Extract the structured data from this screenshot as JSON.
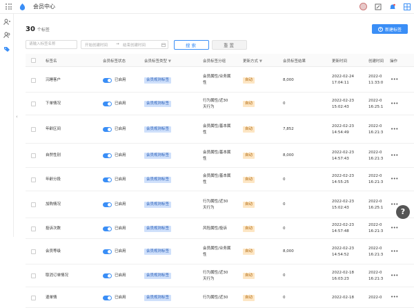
{
  "app": {
    "title": "会员中心"
  },
  "header": {
    "count": "30",
    "count_unit": "个标签",
    "new_button": "新建标签"
  },
  "filters": {
    "name_placeholder": "请输入标签名称",
    "start_placeholder": "开始创建时间",
    "arrow": "→",
    "end_placeholder": "结束创建时间",
    "search_label": "搜索",
    "reset_label": "重置"
  },
  "columns": [
    "标签名",
    "会员标签状态",
    "会员标签类型",
    "会员标签分组",
    "更新方式",
    "会员标签结果",
    "更新时间",
    "创建时间",
    "操作"
  ],
  "rows": [
    {
      "name": "沉睡客户",
      "status": "已启用",
      "type": "会员规则标签",
      "group": [
        "会员属性/业务属",
        "性"
      ],
      "mode": "自动",
      "result": "8,000",
      "updated": [
        "2022-02-24",
        "17:04:11"
      ],
      "created": [
        "2022-0",
        "11:33:0"
      ]
    },
    {
      "name": "下单情况",
      "status": "已启用",
      "type": "会员规则标签",
      "group": [
        "行为属性/近30",
        "天行为"
      ],
      "mode": "自动",
      "result": "0",
      "updated": [
        "2022-02-23",
        "15:02:43"
      ],
      "created": [
        "2022-0",
        "16:25:1"
      ]
    },
    {
      "name": "年龄区间",
      "status": "已启用",
      "type": "会员规则标签",
      "group": [
        "会员属性/基本属",
        "性"
      ],
      "mode": "自动",
      "result": "7,852",
      "updated": [
        "2022-02-23",
        "14:54:49"
      ],
      "created": [
        "2022-0",
        "16:21:3"
      ]
    },
    {
      "name": "自然性别",
      "status": "已启用",
      "type": "会员规则标签",
      "group": [
        "会员属性/基本属",
        "性"
      ],
      "mode": "自动",
      "result": "8,000",
      "updated": [
        "2022-02-23",
        "14:57:43"
      ],
      "created": [
        "2022-0",
        "16:21:3"
      ]
    },
    {
      "name": "年龄分段",
      "status": "已启用",
      "type": "会员规则标签",
      "group": [
        "会员属性/基本属",
        "性"
      ],
      "mode": "自动",
      "result": "0",
      "updated": [
        "2022-02-23",
        "14:55:25"
      ],
      "created": [
        "2022-0",
        "16:21:3"
      ]
    },
    {
      "name": "加购情况",
      "status": "已启用",
      "type": "会员规则标签",
      "group": [
        "行为属性/近30",
        "天行为"
      ],
      "mode": "自动",
      "result": "0",
      "updated": [
        "2022-02-23",
        "15:02:43"
      ],
      "created": [
        "2022-0",
        "16:25:1"
      ]
    },
    {
      "name": "投诉次数",
      "status": "已启用",
      "type": "会员规则标签",
      "group": [
        "风险属性/投诉"
      ],
      "mode": "自动",
      "result": "0",
      "updated": [
        "2022-02-23",
        "14:57:48"
      ],
      "created": [
        "2022-0",
        "16:21:3"
      ]
    },
    {
      "name": "会员等级",
      "status": "已启用",
      "type": "会员规则标签",
      "group": [
        "会员属性/业务属",
        "性"
      ],
      "mode": "自动",
      "result": "8,000",
      "updated": [
        "2022-02-23",
        "14:54:52"
      ],
      "created": [
        "2022-0",
        "16:21:3"
      ]
    },
    {
      "name": "取消订单情况",
      "status": "已启用",
      "type": "会员规则标签",
      "group": [
        "行为属性/近30",
        "天行为"
      ],
      "mode": "自动",
      "result": "0",
      "updated": [
        "2022-02-18",
        "16:03:23"
      ],
      "created": [
        "2022-0",
        "16:21:3"
      ]
    },
    {
      "name": "退单情",
      "status": "已启用",
      "type": "会员规则标签",
      "group": [
        "行为属性/近30"
      ],
      "mode": "自动",
      "result": "0",
      "updated": [
        "2022-02-18"
      ],
      "created": [
        "2022-0"
      ]
    }
  ],
  "help": {
    "label": "?"
  },
  "colors": {
    "accent": "#3a8ef6",
    "type_tag_bg": "#cfe0fb",
    "auto_tag_bg": "#fde6c4"
  },
  "icons": [
    "grid-icon",
    "app-logo-icon",
    "user-avatar",
    "edit-icon",
    "bell-icon",
    "layout-icon",
    "user-icon",
    "users-icon",
    "tag-icon",
    "collapse-arrow-icon",
    "filter-icon",
    "calendar-icon",
    "plus-circle-icon",
    "more-icon",
    "help-icon"
  ]
}
